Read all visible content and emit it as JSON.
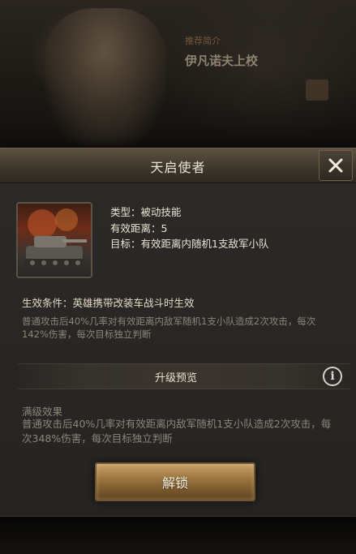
{
  "background": {
    "hero_tag": "推荐简介",
    "hero_name": "伊凡诺夫上校"
  },
  "dialog": {
    "title": "天启使者",
    "close_icon": "close-icon",
    "skill": {
      "icon": "tank-icon",
      "type_line": "类型：被动技能",
      "range_line": "有效距离：5",
      "target_line": "目标：有效距离内随机1支敌军小队"
    },
    "condition": "生效条件：英雄携带改装车战斗时生效",
    "description": "普通攻击后40%几率对有效距离内敌军随机1支小队造成2次攻击，每次142%伤害，每次目标独立判断",
    "upgrade": {
      "title": "升级预览",
      "info_icon": "info-icon",
      "info_glyph": "i"
    },
    "full_effect": {
      "label": "满级效果",
      "description": "普通攻击后40%几率对有效距离内敌军随机1支小队造成2次攻击，每次348%伤害，每次目标独立判断"
    },
    "unlock_label": "解锁"
  },
  "colors": {
    "gold_button": "#a27c45",
    "panel": "#2a2825",
    "muted_text": "#8b857a"
  }
}
